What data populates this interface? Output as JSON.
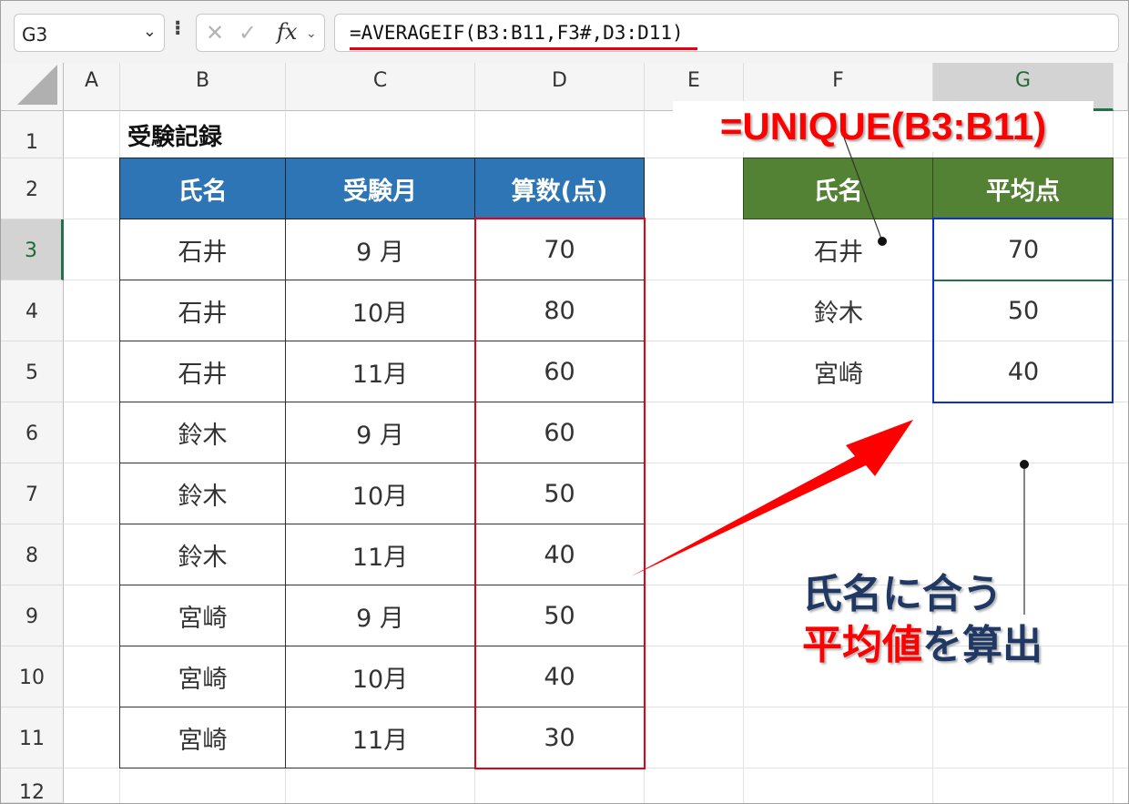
{
  "formula_bar": {
    "name_box": "G3",
    "name_dropdown_icon": "chevron-down-icon",
    "separator": "⁝",
    "cancel_icon": "✕",
    "enter_icon": "✓",
    "fx_label": "fx",
    "formula": "=AVERAGEIF(B3:B11,F3#,D3:D11)"
  },
  "columns": [
    "A",
    "B",
    "C",
    "D",
    "E",
    "F",
    "G"
  ],
  "selected_column": "G",
  "rows": [
    "1",
    "2",
    "3",
    "4",
    "5",
    "6",
    "7",
    "8",
    "9",
    "10",
    "11",
    "12"
  ],
  "selected_row": "3",
  "sheet": {
    "title": "受験記録",
    "table": {
      "headers": [
        "氏名",
        "受験月",
        "算数(点)"
      ],
      "rows": [
        [
          "石井",
          "9 月",
          "70"
        ],
        [
          "石井",
          "10月",
          "80"
        ],
        [
          "石井",
          "11月",
          "60"
        ],
        [
          "鈴木",
          "9 月",
          "60"
        ],
        [
          "鈴木",
          "10月",
          "50"
        ],
        [
          "鈴木",
          "11月",
          "40"
        ],
        [
          "宮崎",
          "9 月",
          "50"
        ],
        [
          "宮崎",
          "10月",
          "40"
        ],
        [
          "宮崎",
          "11月",
          "30"
        ]
      ]
    },
    "summary": {
      "headers": [
        "氏名",
        "平均点"
      ],
      "rows": [
        [
          "石井",
          "70"
        ],
        [
          "鈴木",
          "50"
        ],
        [
          "宮崎",
          "40"
        ]
      ]
    }
  },
  "annotations": {
    "unique_formula": "=UNIQUE(B3:B11)",
    "note_line1": "氏名に合う",
    "note_line2_red": "平均値",
    "note_line2_rest": "を算出"
  },
  "colors": {
    "table_header": "#2e75b6",
    "summary_header": "#548235",
    "highlight_red": "#e60012",
    "highlight_blue": "#0b2fd6",
    "excel_green": "#217346"
  }
}
